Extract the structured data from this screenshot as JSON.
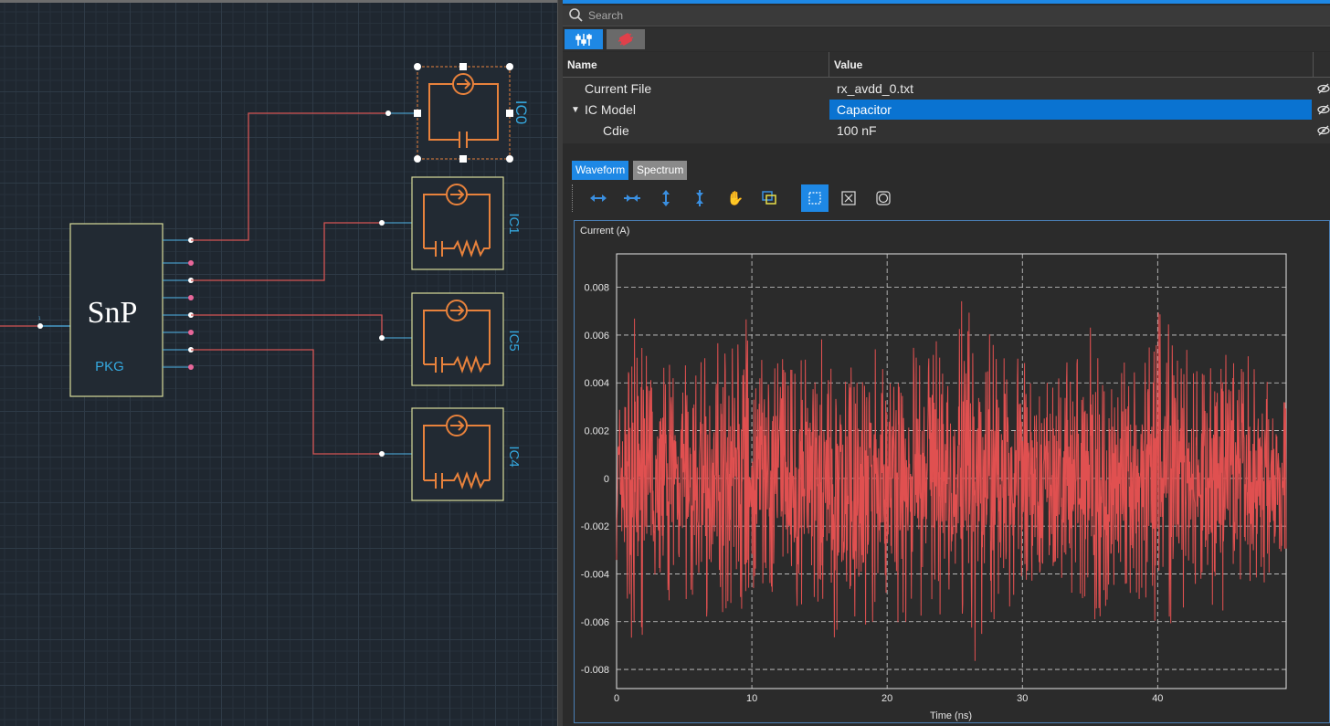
{
  "search": {
    "placeholder": "Search"
  },
  "property_tabs": [
    {
      "icon": "sliders-icon",
      "active": true
    },
    {
      "icon": "chip-bug-icon",
      "active": false
    }
  ],
  "table": {
    "headers": {
      "name": "Name",
      "value": "Value"
    },
    "rows": [
      {
        "name": "Current File",
        "value": "rx_avdd_0.txt"
      },
      {
        "name": "IC Model",
        "value": "Capacitor",
        "expanded": true,
        "selected": true
      },
      {
        "name": "Cdie",
        "value": "100 nF"
      }
    ]
  },
  "chart_tabs": {
    "waveform": "Waveform",
    "spectrum": "Spectrum",
    "active": "Waveform"
  },
  "chart_toolbar": [
    "zoom-in-x-icon",
    "zoom-out-x-icon",
    "zoom-in-y-icon",
    "zoom-out-y-icon",
    "pan-hand-icon",
    "zoom-box-icon",
    "select-box-icon",
    "fit-all-icon",
    "reset-zoom-icon"
  ],
  "schematic": {
    "pkg": {
      "title": "SnP",
      "label": "PKG"
    },
    "ics": [
      {
        "label": "IC0",
        "type": "capacitor",
        "selected": true
      },
      {
        "label": "IC1",
        "type": "resistor"
      },
      {
        "label": "IC5",
        "type": "resistor"
      },
      {
        "label": "IC4",
        "type": "resistor"
      }
    ],
    "colors": {
      "wire": "#d35454",
      "port": "#4fb3e6",
      "symbol": "#e8823c",
      "label": "#35a9e0",
      "box": "#d8dc9a"
    }
  },
  "chart_data": {
    "type": "line",
    "ylabel": "Current (A)",
    "xlabel": "Time (ns)",
    "xlim": [
      0,
      49.5
    ],
    "ylim": [
      -0.0088,
      0.0094
    ],
    "xticks": [
      "0",
      "10",
      "20",
      "30",
      "40"
    ],
    "yticks": [
      "0.008",
      "0.006",
      "0.004",
      "0.002",
      "0",
      "-0.002",
      "-0.004",
      "-0.006",
      "-0.008"
    ],
    "grid": true,
    "series": [
      {
        "color": "#e05050",
        "description_points": [
          [
            0,
            0.002
          ],
          [
            1.2,
            0.0085
          ],
          [
            2.5,
            -0.005
          ],
          [
            4.5,
            0.005
          ],
          [
            6,
            0.006
          ],
          [
            8.5,
            0.0055
          ],
          [
            10,
            -0.008
          ],
          [
            11,
            0.0045
          ],
          [
            14,
            0.006
          ],
          [
            16,
            -0.007
          ],
          [
            19,
            0.006
          ],
          [
            20.5,
            -0.006
          ],
          [
            21,
            0.0065
          ],
          [
            23,
            0.0055
          ],
          [
            26,
            0.0085
          ],
          [
            28,
            0.006
          ],
          [
            30,
            -0.005
          ],
          [
            32,
            0.004
          ],
          [
            34,
            0.0055
          ],
          [
            35,
            -0.0078
          ],
          [
            37,
            0.0045
          ],
          [
            40,
            -0.007
          ],
          [
            43,
            0.005
          ],
          [
            46,
            0.0065
          ],
          [
            49.5,
            0.0035
          ]
        ]
      }
    ]
  }
}
